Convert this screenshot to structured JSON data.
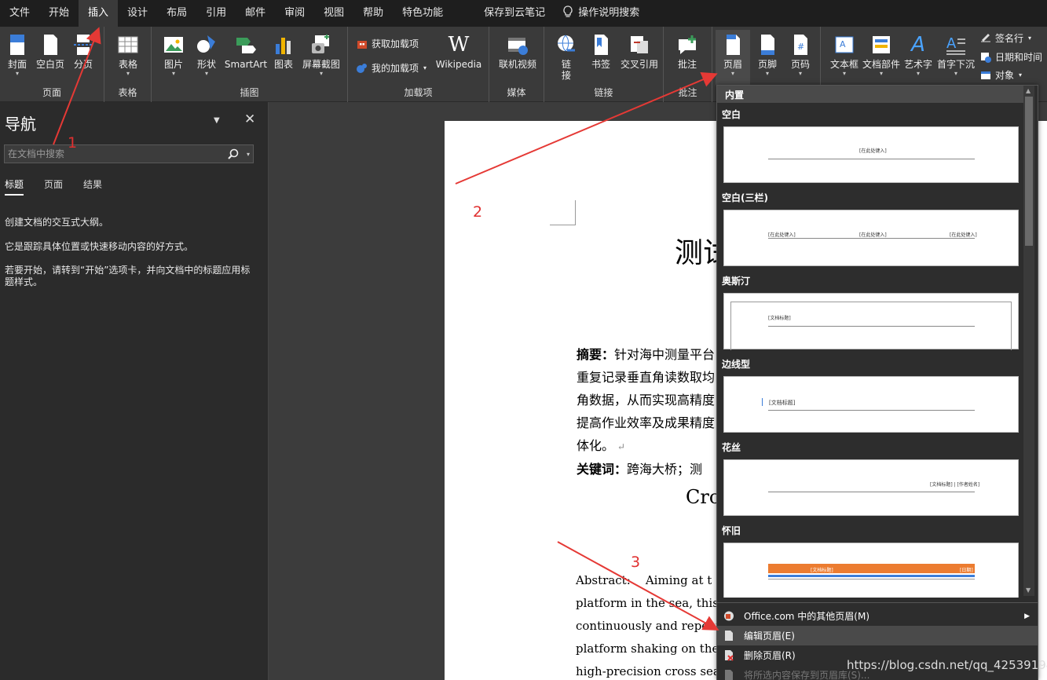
{
  "menubar": {
    "tabs": [
      "文件",
      "开始",
      "插入",
      "设计",
      "布局",
      "引用",
      "邮件",
      "审阅",
      "视图",
      "帮助",
      "特色功能"
    ],
    "active_tab": "插入",
    "save_cloud": "保存到云笔记",
    "tell_me": "操作说明搜索"
  },
  "ribbon": {
    "groups": {
      "pages": "页面",
      "tables": "表格",
      "illustrations": "插图",
      "addins": "加载项",
      "media": "媒体",
      "links": "链接",
      "comments": "批注"
    },
    "buttons": {
      "cover": "封面",
      "blank_page": "空白页",
      "page_break": "分页",
      "table": "表格",
      "picture": "图片",
      "shapes": "形状",
      "smartart": "SmartArt",
      "chart": "图表",
      "screenshot": "屏幕截图",
      "get_addins": "获取加载项",
      "my_addins": "我的加载项",
      "wikipedia": "Wikipedia",
      "online_video": "联机视频",
      "link_1": "链",
      "link_2": "接",
      "bookmark": "书签",
      "cross_ref": "交叉引用",
      "comment": "批注",
      "header": "页眉",
      "footer": "页脚",
      "page_number": "页码",
      "textbox": "文本框",
      "quick_parts": "文档部件",
      "wordart": "艺术字",
      "dropcap": "首字下沉",
      "signature_line": "签名行",
      "date_time": "日期和时间",
      "object": "对象"
    }
  },
  "nav": {
    "title": "导航",
    "search_placeholder": "在文档中搜索",
    "tabs": [
      "标题",
      "页面",
      "结果"
    ],
    "text1": "创建文档的交互式大纲。",
    "text2": "它是跟踪具体位置或快速移动内容的好方式。",
    "text3": "若要开始，请转到“开始”选项卡，并向文档中的标题应用标题样式。"
  },
  "doc": {
    "title": "测试",
    "abstract_label": "摘要：",
    "line1": "针对海中测量平台",
    "line2": "重复记录垂直角读数取均",
    "line3": "角数据，从而实现高精度",
    "line4": "提高作业效率及成果精度",
    "line5": "体化。",
    "keywords_label": "关键词：",
    "keywords": "跨海大桥；测",
    "cro": "Cro",
    "en_label": "Abstract:",
    "en1": "Aiming at t",
    "en2": "platform in the sea, this pap",
    "en3": "continuously and repeat",
    "en4": "platform shaking on the ve",
    "en5": "high-precision cross sea e"
  },
  "dropdown": {
    "header": "内置",
    "sections": [
      "空白",
      "空白(三栏)",
      "奥斯汀",
      "边线型",
      "花丝",
      "怀旧"
    ],
    "thumb_text": {
      "blank": "[在此处键入]",
      "austin": "[文档标题]",
      "sideline": "[文档标题]",
      "filigree": "[文档标题] | [作者姓名]",
      "retro_left": "[文档标题]",
      "retro_right": "[日期]"
    },
    "menu": {
      "more": "Office.com 中的其他页眉(M)",
      "edit": "编辑页眉(E)",
      "remove": "删除页眉(R)",
      "save": "将所选内容保存到页眉库(S)..."
    }
  },
  "annotations": {
    "n1": "1",
    "n2": "2",
    "n3": "3",
    "color": "#e53935"
  },
  "watermark": "https://blog.csdn.net/qq_42539194"
}
